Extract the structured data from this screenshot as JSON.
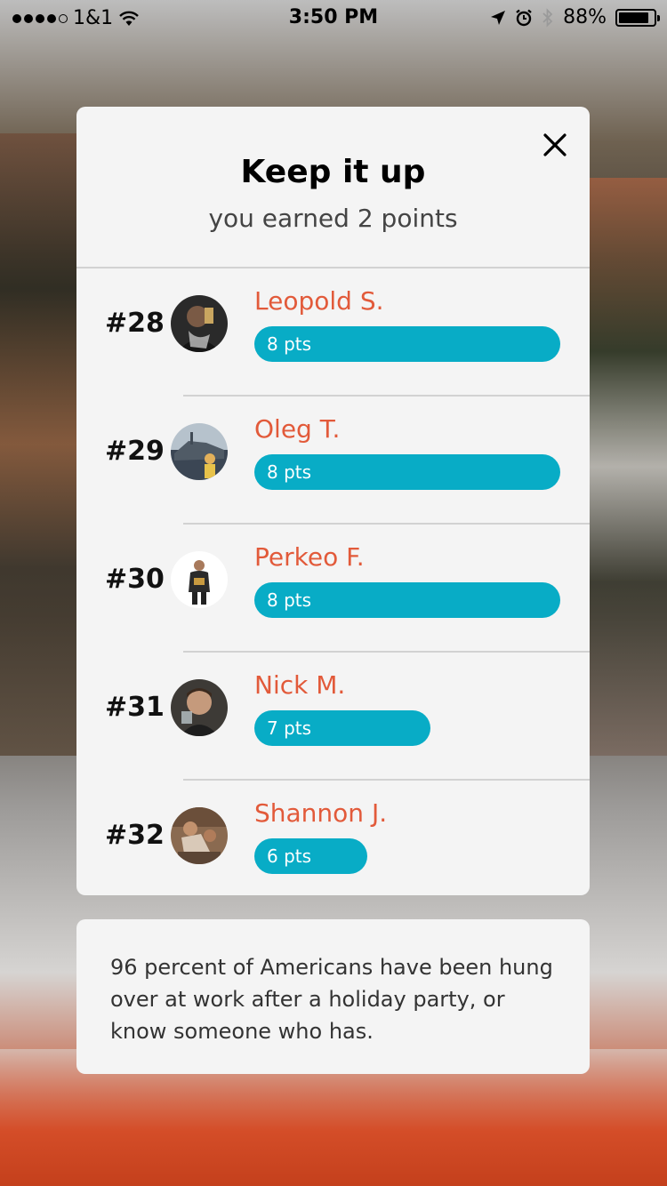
{
  "status_bar": {
    "carrier": "1&1",
    "time": "3:50 PM",
    "battery": "88%",
    "battery_level": 0.88
  },
  "dialog": {
    "title": "Keep it up",
    "subtitle": "you earned 2 points"
  },
  "leaderboard": [
    {
      "rank": "#28",
      "name": "Leopold S.",
      "points": "8 pts",
      "value": 8
    },
    {
      "rank": "#29",
      "name": "Oleg T.",
      "points": "8 pts",
      "value": 8
    },
    {
      "rank": "#30",
      "name": "Perkeo F.",
      "points": "8 pts",
      "value": 8
    },
    {
      "rank": "#31",
      "name": "Nick M.",
      "points": "7 pts",
      "value": 7
    },
    {
      "rank": "#32",
      "name": "Shannon J.",
      "points": "6 pts",
      "value": 6
    }
  ],
  "fact": {
    "text": "96 percent of Americans have been hung over at work after a holiday party, or know someone who has."
  },
  "colors": {
    "accent_name": "#e25a3a",
    "bar": "#08acc6",
    "card": "#f4f4f4"
  },
  "icons": {
    "close": "close-icon",
    "wifi": "wifi-icon",
    "location": "location-arrow-icon",
    "alarm": "alarm-icon",
    "bluetooth": "bluetooth-icon",
    "battery": "battery-icon"
  }
}
